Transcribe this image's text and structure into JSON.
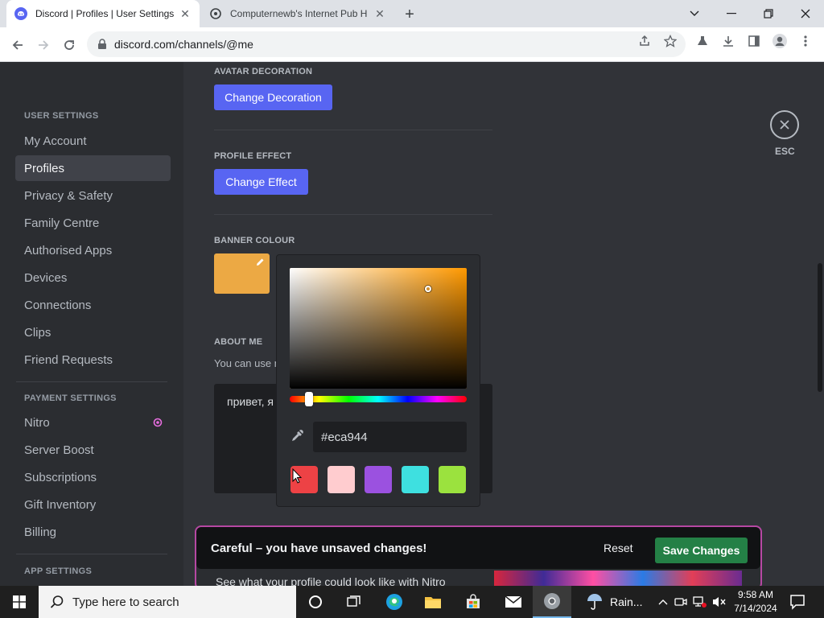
{
  "browser": {
    "tabs": [
      {
        "title": "Discord | Profiles | User Settings",
        "active": true
      },
      {
        "title": "Computernewb's Internet Pub H",
        "active": false
      }
    ],
    "url": "discord.com/channels/@me"
  },
  "sidebar": {
    "user_settings_header": "USER SETTINGS",
    "user_items": [
      "My Account",
      "Profiles",
      "Privacy & Safety",
      "Family Centre",
      "Authorised Apps",
      "Devices",
      "Connections",
      "Clips",
      "Friend Requests"
    ],
    "selected": "Profiles",
    "payment_settings_header": "PAYMENT SETTINGS",
    "payment_items": [
      "Nitro",
      "Server Boost",
      "Subscriptions",
      "Gift Inventory",
      "Billing"
    ],
    "app_settings_header": "APP SETTINGS"
  },
  "profile": {
    "avatar_decoration_label": "AVATAR DECORATION",
    "change_decoration": "Change Decoration",
    "profile_effect_label": "PROFILE EFFECT",
    "change_effect": "Change Effect",
    "banner_colour_label": "BANNER COLOUR",
    "banner_colour": "#eca944",
    "about_me_label": "ABOUT ME",
    "about_me_sub": "You can use m",
    "about_me_text": "привет, я"
  },
  "color_picker": {
    "hex_value": "#eca944",
    "presets": [
      "#ed4245",
      "#ffcccf",
      "#9b51e0",
      "#3ee0e0",
      "#9be23e"
    ]
  },
  "close": {
    "label": "ESC"
  },
  "unsaved": {
    "message": "Careful – you have unsaved changes!",
    "reset": "Reset",
    "save": "Save Changes",
    "preview_text": "See what your profile could look like with Nitro"
  },
  "taskbar": {
    "search_placeholder": "Type here to search",
    "weather": "Rain...",
    "time": "9:58 AM",
    "date": "7/14/2024"
  },
  "colors": {
    "brand": "#5865f2",
    "save_green": "#248046",
    "sidebar_bg": "#2b2d31",
    "content_bg": "#313338"
  }
}
